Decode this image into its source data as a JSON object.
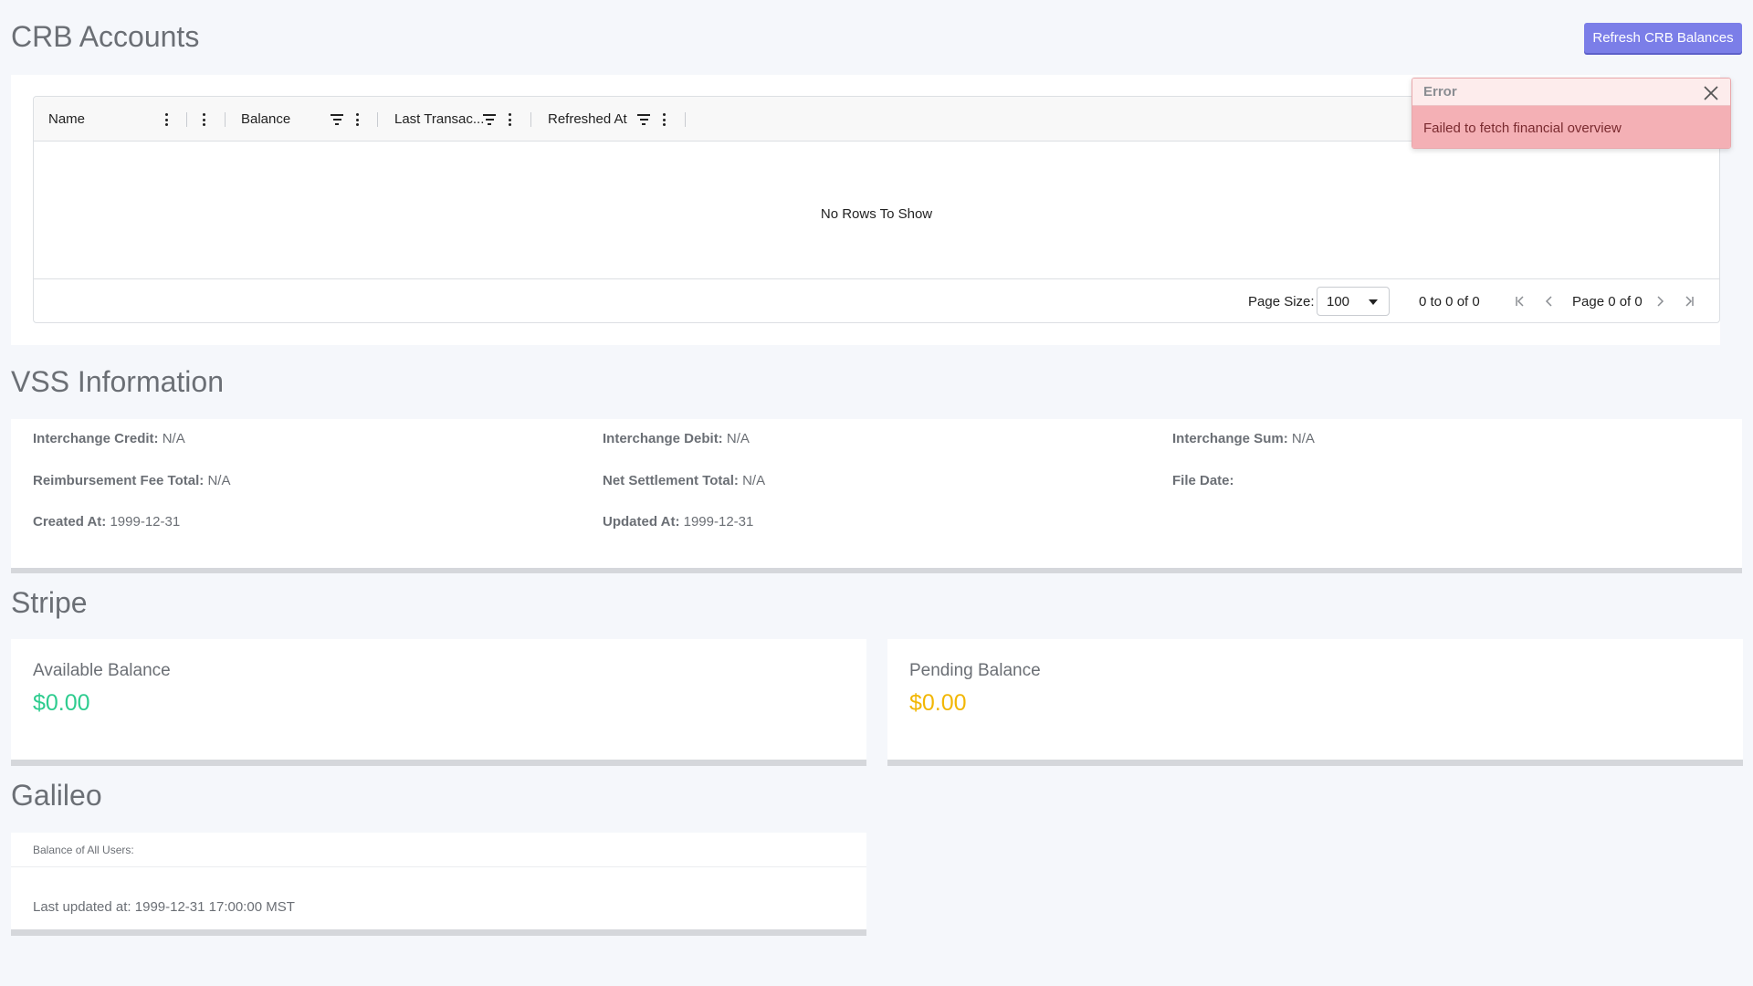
{
  "crb": {
    "title": "CRB Accounts",
    "refresh_label": "Refresh CRB Balances",
    "columns": [
      "Name",
      "Balance",
      "Last Transac...",
      "Refreshed At"
    ],
    "no_rows": "No Rows To Show",
    "page_size_label": "Page Size:",
    "page_size_value": "100",
    "range_text": "0 to 0 of 0",
    "page_text": "Page 0 of 0"
  },
  "toast": {
    "title": "Error",
    "message": "Failed to fetch financial overview"
  },
  "vss": {
    "title": "VSS Information",
    "items": [
      {
        "label": "Interchange Credit:",
        "value": "N/A"
      },
      {
        "label": "Interchange Debit:",
        "value": "N/A"
      },
      {
        "label": "Interchange Sum:",
        "value": "N/A"
      },
      {
        "label": "Reimbursement Fee Total:",
        "value": "N/A"
      },
      {
        "label": "Net Settlement Total:",
        "value": "N/A"
      },
      {
        "label": "File Date:",
        "value": ""
      },
      {
        "label": "Created At:",
        "value": "1999-12-31"
      },
      {
        "label": "Updated At:",
        "value": "1999-12-31"
      }
    ]
  },
  "stripe": {
    "title": "Stripe",
    "available_label": "Available Balance",
    "available_value": "$0.00",
    "pending_label": "Pending Balance",
    "pending_value": "$0.00",
    "available_color": "#2ecc8f",
    "pending_color": "#f2b705"
  },
  "galileo": {
    "title": "Galileo",
    "subtitle": "Balance of All Users:",
    "updated": "Last updated at: 1999-12-31 17:00:00 MST"
  },
  "icons": [
    "kebab-menu-icon",
    "filter-icon",
    "chevron-down-icon",
    "first-page-icon",
    "previous-page-icon",
    "next-page-icon",
    "last-page-icon",
    "close-icon"
  ]
}
